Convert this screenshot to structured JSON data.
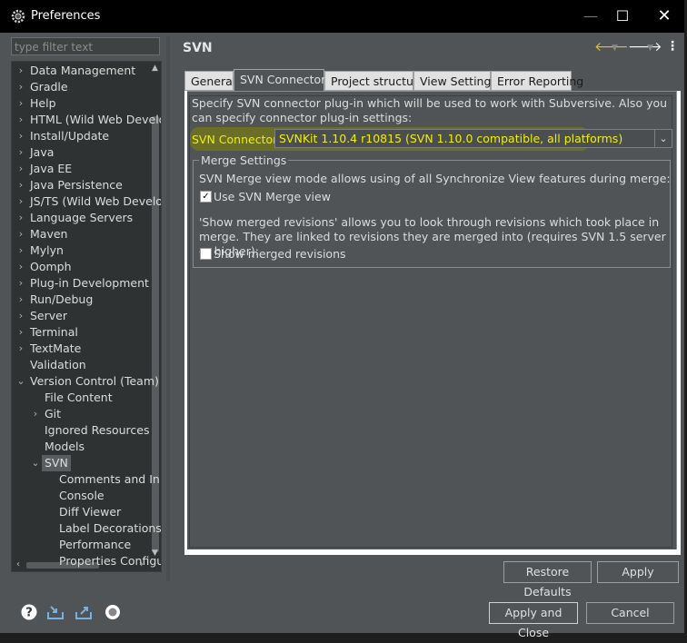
{
  "window": {
    "title": "Preferences",
    "icon": "gear-icon"
  },
  "filter": {
    "placeholder": "type filter text"
  },
  "tree": {
    "items": [
      {
        "label": "Data Management",
        "chevron": "›"
      },
      {
        "label": "Gradle",
        "chevron": "›"
      },
      {
        "label": "Help",
        "chevron": "›"
      },
      {
        "label": "HTML (Wild Web Develo",
        "chevron": "›"
      },
      {
        "label": "Install/Update",
        "chevron": "›"
      },
      {
        "label": "Java",
        "chevron": "›"
      },
      {
        "label": "Java EE",
        "chevron": "›"
      },
      {
        "label": "Java Persistence",
        "chevron": "›"
      },
      {
        "label": "JS/TS (Wild Web Develo",
        "chevron": "›"
      },
      {
        "label": "Language Servers",
        "chevron": "›"
      },
      {
        "label": "Maven",
        "chevron": "›"
      },
      {
        "label": "Mylyn",
        "chevron": "›"
      },
      {
        "label": "Oomph",
        "chevron": "›"
      },
      {
        "label": "Plug-in Development",
        "chevron": "›"
      },
      {
        "label": "Run/Debug",
        "chevron": "›"
      },
      {
        "label": "Server",
        "chevron": "›"
      },
      {
        "label": "Terminal",
        "chevron": "›"
      },
      {
        "label": "TextMate",
        "chevron": "›"
      },
      {
        "label": "Validation",
        "chevron": ""
      },
      {
        "label": "Version Control (Team)",
        "chevron": "⌄"
      },
      {
        "label": "File Content",
        "chevron": ""
      },
      {
        "label": "Git",
        "chevron": "›"
      },
      {
        "label": "Ignored Resources",
        "chevron": ""
      },
      {
        "label": "Models",
        "chevron": ""
      },
      {
        "label": "SVN",
        "chevron": "⌄"
      },
      {
        "label": "Comments and In",
        "chevron": ""
      },
      {
        "label": "Console",
        "chevron": ""
      },
      {
        "label": "Diff Viewer",
        "chevron": ""
      },
      {
        "label": "Label Decorations",
        "chevron": ""
      },
      {
        "label": "Performance",
        "chevron": ""
      },
      {
        "label": "Properties Configu",
        "chevron": ""
      }
    ]
  },
  "page": {
    "title": "SVN"
  },
  "tabs": [
    {
      "label": "General"
    },
    {
      "label": "SVN Connector"
    },
    {
      "label": "Project structure"
    },
    {
      "label": "View Settings"
    },
    {
      "label": "Error Reporting"
    }
  ],
  "connector": {
    "description": "Specify SVN connector plug-in which will be used to work with Subversive. Also you can specify connector plug-in settings:",
    "label": "SVN Connector:",
    "value": "SVNKit 1.10.4 r10815 (SVN 1.10.0 compatible, all platforms)"
  },
  "merge": {
    "group_title": "Merge Settings",
    "desc1": "SVN Merge view mode allows using of all Synchronize View features during merge:",
    "use_merge_view": "Use SVN Merge view",
    "use_merge_view_checked": true,
    "desc2": "'Show merged revisions' allows you to look through revisions which took place in merge. They are linked to revisions they are merged into (requires SVN 1.5 server or higher):",
    "show_merged_revisions": "Show merged revisions",
    "show_merged_revisions_checked": false
  },
  "buttons": {
    "restore_defaults": "Restore Defaults",
    "apply": "Apply",
    "apply_and_close": "Apply and Close",
    "cancel": "Cancel"
  },
  "colors": {
    "highlight_text": "#f0f000",
    "background": "#505456"
  }
}
